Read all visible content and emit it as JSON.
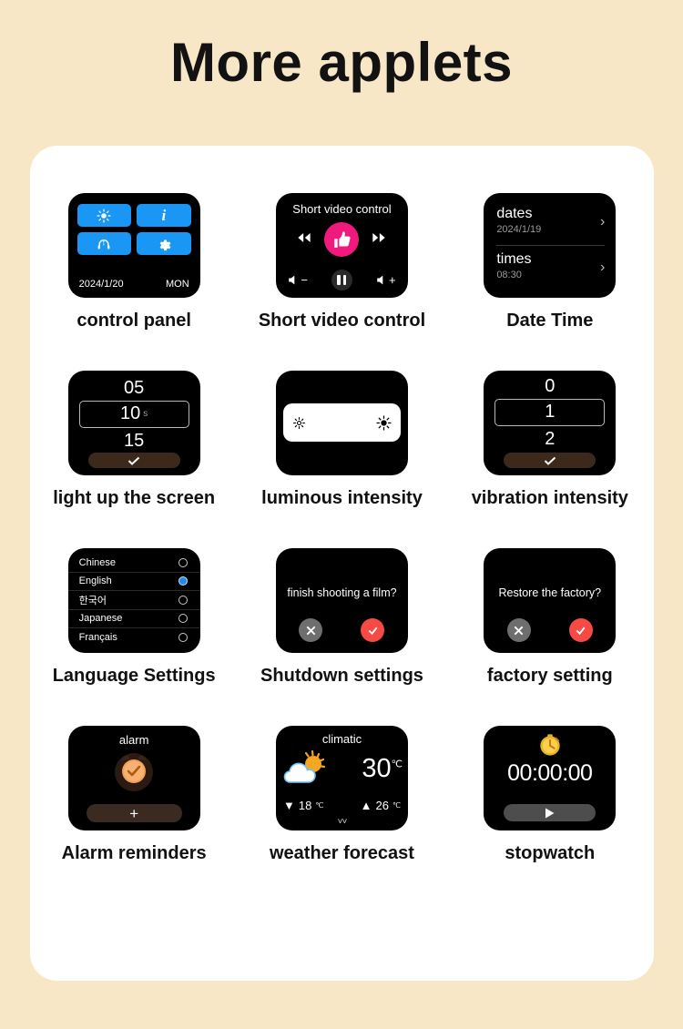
{
  "page": {
    "title": "More applets",
    "background_color": "#f7e7c6",
    "card_color": "#ffffff",
    "accent_blue": "#1a96f5",
    "accent_pink": "#f0197e",
    "accent_red": "#f54b44",
    "accent_brown": "#3d281c"
  },
  "tiles": {
    "control_panel": {
      "caption": "control panel",
      "buttons": [
        "brightness-icon",
        "info-icon",
        "bluetooth-headphones-icon",
        "gear-icon"
      ],
      "date": "2024/1/20",
      "weekday": "MON"
    },
    "short_video": {
      "caption": "Short video control",
      "screen_title": "Short video control",
      "icons": [
        "rewind-icon",
        "thumbs-up-icon",
        "fast-forward-icon",
        "volume-down-icon",
        "pause-icon",
        "volume-up-icon"
      ]
    },
    "date_time": {
      "caption": "Date Time",
      "rows": [
        {
          "label": "dates",
          "value": "2024/1/19"
        },
        {
          "label": "times",
          "value": "08:30"
        }
      ],
      "chevron": "›"
    },
    "light_up": {
      "caption": "light up the screen",
      "options": [
        "05",
        "10",
        "15"
      ],
      "selected": "10",
      "unit": "s",
      "confirm": "check-icon"
    },
    "luminous": {
      "caption": "luminous intensity",
      "icons": [
        "brightness-low-icon",
        "brightness-high-icon"
      ]
    },
    "vibration": {
      "caption": "vibration intensity",
      "options": [
        "0",
        "1",
        "2"
      ],
      "selected": "1",
      "unit": "",
      "confirm": "check-icon"
    },
    "language": {
      "caption": "Language Settings",
      "options": [
        {
          "label": "Chinese",
          "selected": false
        },
        {
          "label": "English",
          "selected": true
        },
        {
          "label": "한국어",
          "selected": false
        },
        {
          "label": "Japanese",
          "selected": false
        },
        {
          "label": "Français",
          "selected": false
        }
      ]
    },
    "shutdown": {
      "caption": "Shutdown settings",
      "question": "finish shooting a film?",
      "cancel": "close-icon",
      "confirm": "check-icon"
    },
    "factory": {
      "caption": "factory setting",
      "question": "Restore the factory?",
      "cancel": "close-icon",
      "confirm": "check-icon"
    },
    "alarm": {
      "caption": "Alarm reminders",
      "screen_title": "alarm",
      "icon": "alarm-clock-icon",
      "add_label": "+"
    },
    "weather": {
      "caption": "weather forecast",
      "screen_title": "climatic",
      "icon": "sun-behind-cloud-icon",
      "current_temp": "30",
      "unit": "℃",
      "low": "18",
      "high": "26",
      "low_unit": "℃",
      "high_unit": "℃",
      "more": "˅˅"
    },
    "stopwatch": {
      "caption": "stopwatch",
      "icon": "stopwatch-icon",
      "time": "00:00:00",
      "play": "play-icon"
    }
  }
}
